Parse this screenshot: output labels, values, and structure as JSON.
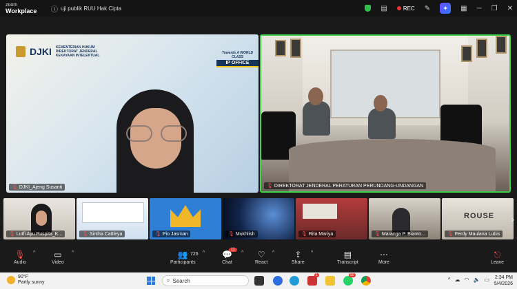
{
  "app": {
    "brand_line1": "zoom",
    "brand_line2": "Workplace",
    "meeting_title": "uji publik RUU Hak Cipta"
  },
  "titlebar": {
    "rec_label": "REC",
    "colors": {
      "shield": "#2fbf4a",
      "rec": "#e33333"
    }
  },
  "main_tiles": [
    {
      "name": "DJKI_Ajeng Susanti",
      "muted": true,
      "banner": {
        "org_lines": [
          "KEMENTERIAN HUKUM",
          "DIREKTORAT JENDERAL",
          "KEKAYAAN INTELEKTUAL"
        ],
        "mark": "DJKI",
        "tagline": "Towards A WORLD CLASS",
        "badge": "IP OFFICE"
      }
    },
    {
      "name": "DIREKTORAT JENDERAL PERATURAN PERUNDANG-UNDANGAN",
      "muted": true,
      "active_speaker": true
    }
  ],
  "thumbnails": [
    {
      "name": "Lutfi Ayu Puspita_K...",
      "muted": true
    },
    {
      "name": "Sintha Cattleya",
      "muted": true
    },
    {
      "name": "Pio Jasman",
      "muted": true
    },
    {
      "name": "Mukhlish",
      "muted": true
    },
    {
      "name": "Rita Mariya",
      "muted": true
    },
    {
      "name": "Maranga P. Bianto...",
      "muted": true
    },
    {
      "name": "Ferdy Maulana Lubis",
      "muted": true,
      "sign_text": "ROUSE"
    }
  ],
  "controls": {
    "audio": "Audio",
    "video": "Video",
    "participants": "Participants",
    "participants_count": "726",
    "chat": "Chat",
    "chat_badge": "11",
    "react": "React",
    "share": "Share",
    "transcript": "Transcript",
    "more": "More",
    "leave": "Leave"
  },
  "taskbar": {
    "temperature": "90°F",
    "weather": "Partly sunny",
    "search_placeholder": "Search",
    "teams_badge": "1",
    "whatsapp_badge": "50",
    "time": "2:34 PM",
    "date": "5/4/2026"
  }
}
